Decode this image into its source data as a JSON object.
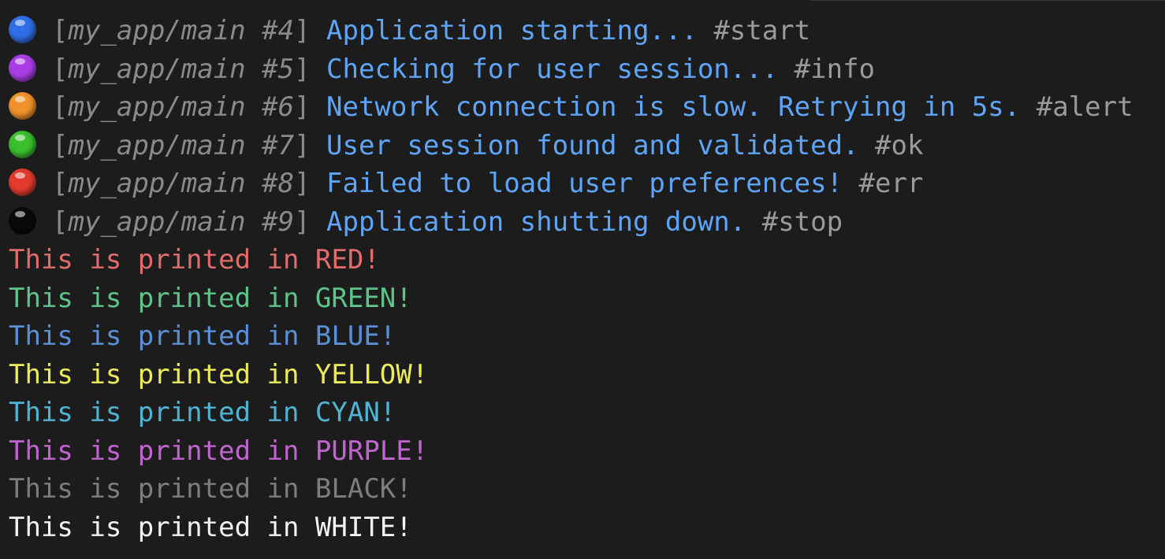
{
  "log_lines": [
    {
      "dot_color": "#2f6ee6",
      "dot_icon": "blue-circle-icon",
      "context": "my_app/main #4",
      "message": "Application starting...",
      "tag": "#start"
    },
    {
      "dot_color": "#a93ee6",
      "dot_icon": "purple-circle-icon",
      "context": "my_app/main #5",
      "message": "Checking for user session...",
      "tag": "#info"
    },
    {
      "dot_color": "#f0922a",
      "dot_icon": "orange-circle-icon",
      "context": "my_app/main #6",
      "message": "Network connection is slow. Retrying in 5s.",
      "tag": "#alert"
    },
    {
      "dot_color": "#3bbf2e",
      "dot_icon": "green-circle-icon",
      "context": "my_app/main #7",
      "message": "User session found and validated.",
      "tag": "#ok"
    },
    {
      "dot_color": "#e23b2e",
      "dot_icon": "red-circle-icon",
      "context": "my_app/main #8",
      "message": "Failed to load user preferences!",
      "tag": "#err"
    },
    {
      "dot_color": "#0a0a0a",
      "dot_icon": "black-circle-icon",
      "context": "my_app/main #9",
      "message": "Application shutting down.",
      "tag": "#stop"
    }
  ],
  "color_lines": [
    {
      "text": "This is printed in RED!",
      "color": "#e06c6c"
    },
    {
      "text": "This is printed in GREEN!",
      "color": "#5fc38a"
    },
    {
      "text": "This is printed in BLUE!",
      "color": "#5b8fd6"
    },
    {
      "text": "This is printed in YELLOW!",
      "color": "#ecec5a"
    },
    {
      "text": "This is printed in CYAN!",
      "color": "#4fb4d4"
    },
    {
      "text": "This is printed in PURPLE!",
      "color": "#c065cf"
    },
    {
      "text": "This is printed in BLACK!",
      "color": "#7d7d7d"
    },
    {
      "text": "This is printed in WHITE!",
      "color": "#f2f2f2"
    }
  ]
}
